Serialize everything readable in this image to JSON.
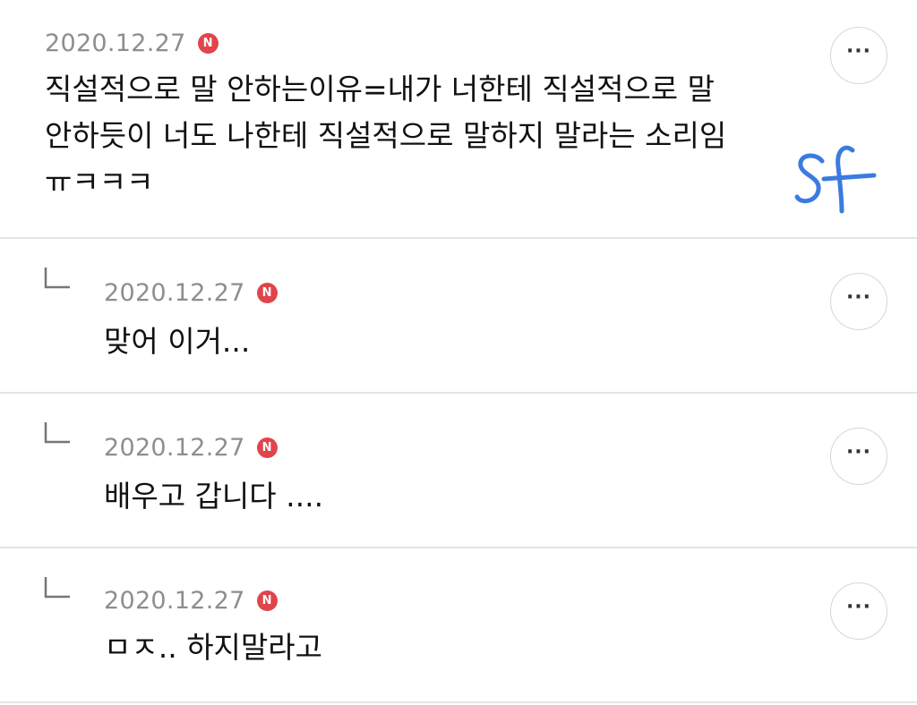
{
  "comments": [
    {
      "date": "2020.12.27",
      "badge": "N",
      "text": "직설적으로 말 안하는이유=내가 너한테 직설적으로 말\n안하듯이 너도 나한테 직설적으로 말하지 말라는 소리임\nㅠㅋㅋㅋ",
      "more": "···"
    },
    {
      "date": "2020.12.27",
      "badge": "N",
      "text": "맞어 이거...",
      "more": "···"
    },
    {
      "date": "2020.12.27",
      "badge": "N",
      "text": "배우고 갑니다 ....",
      "more": "···"
    },
    {
      "date": "2020.12.27",
      "badge": "N",
      "text": "ㅁㅈ.. 하지말라고",
      "more": "···"
    }
  ],
  "annotation": {
    "signature_color": "#3b7be0"
  }
}
